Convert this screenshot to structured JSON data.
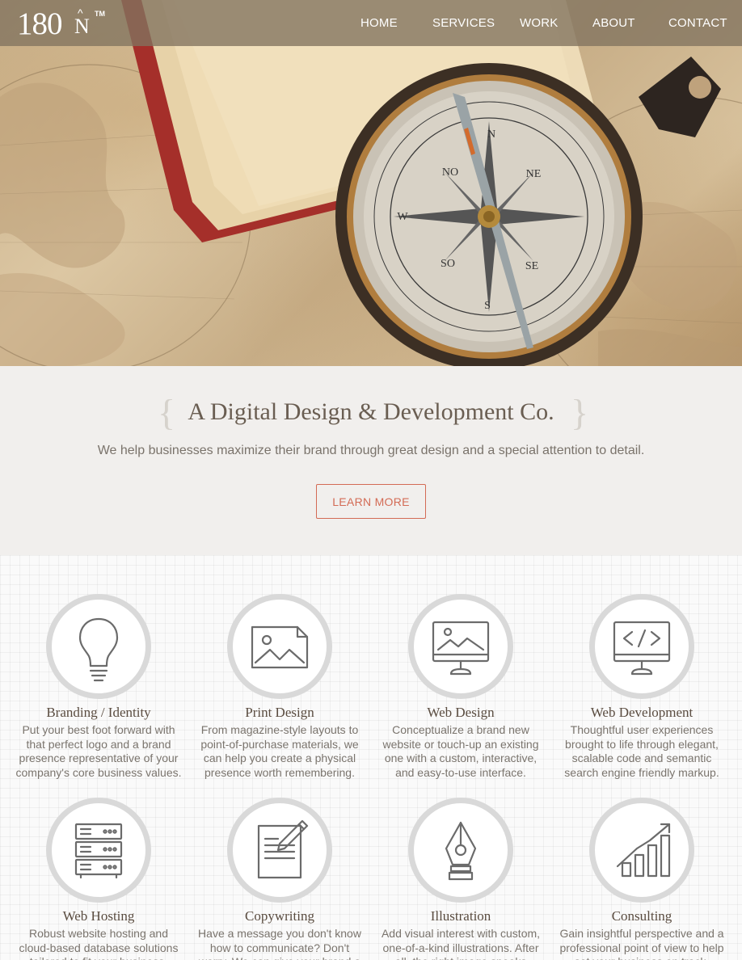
{
  "brand": {
    "number": "180",
    "letter": "N",
    "caret": "^",
    "tm": "TM"
  },
  "nav": {
    "items": [
      "HOME",
      "SERVICES",
      "WORK",
      "ABOUT",
      "CONTACT"
    ]
  },
  "hero": {
    "compass_marks": [
      "N",
      "NE",
      "NO",
      "W",
      "SO",
      "SE",
      "S"
    ]
  },
  "intro": {
    "tagline": "A Digital Design & Development Co.",
    "text": "We help businesses maximize their brand through great design and a special attention to detail.",
    "button": "LEARN MORE"
  },
  "services": [
    {
      "title": "Branding / Identity",
      "desc": "Put your best foot forward with that perfect logo and a brand presence representative of your company's core business values.",
      "icon": "lightbulb-icon"
    },
    {
      "title": "Print Design",
      "desc": "From magazine-style layouts to point-of-purchase materials, we can help you create a physical presence worth remembering.",
      "icon": "image-document-icon"
    },
    {
      "title": "Web Design",
      "desc": "Conceptualize a brand new website or touch-up an existing one with a custom, interactive, and easy-to-use interface.",
      "icon": "monitor-image-icon"
    },
    {
      "title": "Web Development",
      "desc": "Thoughtful user experiences brought to life through elegant, scalable code and semantic search engine friendly markup.",
      "icon": "monitor-code-icon"
    },
    {
      "title": "Web Hosting",
      "desc": "Robust website hosting and cloud-based database solutions tailored to fit your business.",
      "icon": "server-icon"
    },
    {
      "title": "Copywriting",
      "desc": "Have a message you don't know how to communicate?  Don't worry. We can give your brand a voice.",
      "icon": "pencil-document-icon"
    },
    {
      "title": "Illustration",
      "desc": "Add visual interest with custom, one-of-a-kind illustrations. After all, the right image speaks volumes.",
      "icon": "pen-nib-icon"
    },
    {
      "title": "Consulting",
      "desc": "Gain insightful perspective and a professional point of view to help set your business on track.",
      "icon": "growth-chart-icon"
    }
  ]
}
